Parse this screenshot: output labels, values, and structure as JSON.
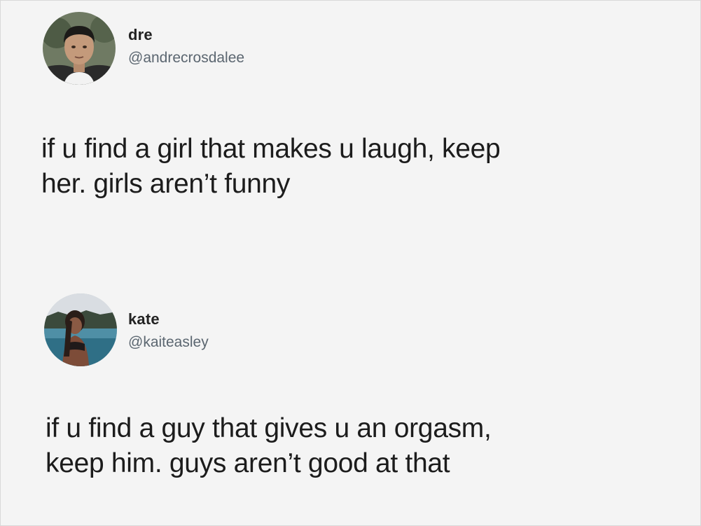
{
  "tweets": [
    {
      "display_name": "dre",
      "handle": "@andrecrosdalee",
      "text_lines": [
        "if u find a girl that makes u laugh, keep",
        "her. girls aren’t funny"
      ]
    },
    {
      "display_name": "kate",
      "handle": "@kaiteasley",
      "text_lines": [
        "if u find a guy that gives u an orgasm,",
        "keep him. guys aren’t good at that"
      ]
    }
  ]
}
